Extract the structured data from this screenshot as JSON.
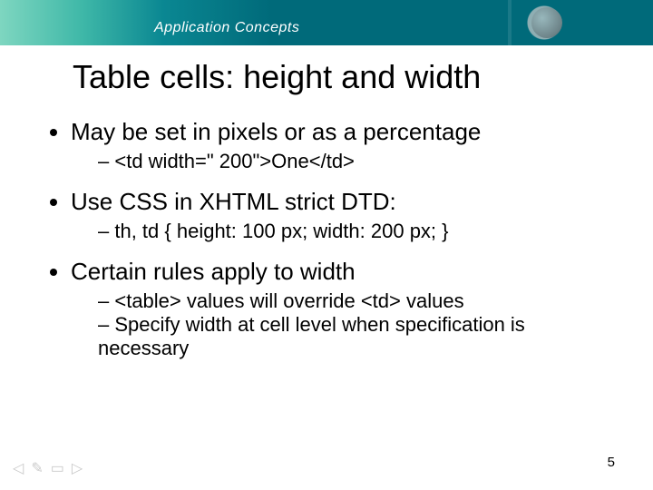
{
  "banner": {
    "brand": "Application Concepts"
  },
  "title": "Table cells: height and width",
  "bullets": {
    "b1": {
      "text": "May be set in pixels or as a percentage",
      "sub": [
        "<td width=\" 200\">One</td>"
      ]
    },
    "b2": {
      "text": " Use CSS in XHTML strict DTD:",
      "sub": [
        "th, td { height: 100 px; width: 200 px; }"
      ]
    },
    "b3": {
      "text": "Certain rules apply to width",
      "sub": [
        "<table> values will override <td> values",
        "Specify width at cell level when specification is necessary"
      ]
    }
  },
  "page_number": "5",
  "nav_icons": {
    "prev": "◁",
    "edit": "✎",
    "screen": "▭",
    "next": "▷"
  }
}
